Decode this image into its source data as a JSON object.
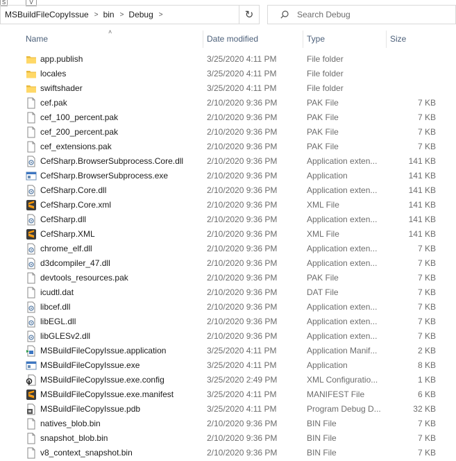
{
  "toolbar_stubs": [
    "S",
    "V"
  ],
  "address": {
    "crumbs": [
      "MSBuildFileCopyIssue",
      "bin",
      "Debug"
    ]
  },
  "search": {
    "placeholder": "Search Debug"
  },
  "columns": {
    "name": "Name",
    "date": "Date modified",
    "type": "Type",
    "size": "Size"
  },
  "files": [
    {
      "name": "app.publish",
      "date": "3/25/2020 4:11 PM",
      "type": "File folder",
      "size": "",
      "icon": "folder-icon"
    },
    {
      "name": "locales",
      "date": "3/25/2020 4:11 PM",
      "type": "File folder",
      "size": "",
      "icon": "folder-icon"
    },
    {
      "name": "swiftshader",
      "date": "3/25/2020 4:11 PM",
      "type": "File folder",
      "size": "",
      "icon": "folder-icon"
    },
    {
      "name": "cef.pak",
      "date": "2/10/2020 9:36 PM",
      "type": "PAK File",
      "size": "7 KB",
      "icon": "file-icon"
    },
    {
      "name": "cef_100_percent.pak",
      "date": "2/10/2020 9:36 PM",
      "type": "PAK File",
      "size": "7 KB",
      "icon": "file-icon"
    },
    {
      "name": "cef_200_percent.pak",
      "date": "2/10/2020 9:36 PM",
      "type": "PAK File",
      "size": "7 KB",
      "icon": "file-icon"
    },
    {
      "name": "cef_extensions.pak",
      "date": "2/10/2020 9:36 PM",
      "type": "PAK File",
      "size": "7 KB",
      "icon": "file-icon"
    },
    {
      "name": "CefSharp.BrowserSubprocess.Core.dll",
      "date": "2/10/2020 9:36 PM",
      "type": "Application exten...",
      "size": "141 KB",
      "icon": "dll-icon"
    },
    {
      "name": "CefSharp.BrowserSubprocess.exe",
      "date": "2/10/2020 9:36 PM",
      "type": "Application",
      "size": "141 KB",
      "icon": "exe-icon"
    },
    {
      "name": "CefSharp.Core.dll",
      "date": "2/10/2020 9:36 PM",
      "type": "Application exten...",
      "size": "141 KB",
      "icon": "dll-icon"
    },
    {
      "name": "CefSharp.Core.xml",
      "date": "2/10/2020 9:36 PM",
      "type": "XML File",
      "size": "141 KB",
      "icon": "sublime-icon"
    },
    {
      "name": "CefSharp.dll",
      "date": "2/10/2020 9:36 PM",
      "type": "Application exten...",
      "size": "141 KB",
      "icon": "dll-icon"
    },
    {
      "name": "CefSharp.XML",
      "date": "2/10/2020 9:36 PM",
      "type": "XML File",
      "size": "141 KB",
      "icon": "sublime-icon"
    },
    {
      "name": "chrome_elf.dll",
      "date": "2/10/2020 9:36 PM",
      "type": "Application exten...",
      "size": "7 KB",
      "icon": "dll-icon"
    },
    {
      "name": "d3dcompiler_47.dll",
      "date": "2/10/2020 9:36 PM",
      "type": "Application exten...",
      "size": "7 KB",
      "icon": "dll-icon"
    },
    {
      "name": "devtools_resources.pak",
      "date": "2/10/2020 9:36 PM",
      "type": "PAK File",
      "size": "7 KB",
      "icon": "file-icon"
    },
    {
      "name": "icudtl.dat",
      "date": "2/10/2020 9:36 PM",
      "type": "DAT File",
      "size": "7 KB",
      "icon": "file-icon"
    },
    {
      "name": "libcef.dll",
      "date": "2/10/2020 9:36 PM",
      "type": "Application exten...",
      "size": "7 KB",
      "icon": "dll-icon"
    },
    {
      "name": "libEGL.dll",
      "date": "2/10/2020 9:36 PM",
      "type": "Application exten...",
      "size": "7 KB",
      "icon": "dll-icon"
    },
    {
      "name": "libGLESv2.dll",
      "date": "2/10/2020 9:36 PM",
      "type": "Application exten...",
      "size": "7 KB",
      "icon": "dll-icon"
    },
    {
      "name": "MSBuildFileCopyIssue.application",
      "date": "3/25/2020 4:11 PM",
      "type": "Application Manif...",
      "size": "2 KB",
      "icon": "manifest-app-icon"
    },
    {
      "name": "MSBuildFileCopyIssue.exe",
      "date": "3/25/2020 4:11 PM",
      "type": "Application",
      "size": "8 KB",
      "icon": "exe-icon"
    },
    {
      "name": "MSBuildFileCopyIssue.exe.config",
      "date": "3/25/2020 2:49 PM",
      "type": "XML Configuratio...",
      "size": "1 KB",
      "icon": "config-icon"
    },
    {
      "name": "MSBuildFileCopyIssue.exe.manifest",
      "date": "3/25/2020 4:11 PM",
      "type": "MANIFEST File",
      "size": "6 KB",
      "icon": "sublime-icon"
    },
    {
      "name": "MSBuildFileCopyIssue.pdb",
      "date": "3/25/2020 4:11 PM",
      "type": "Program Debug D...",
      "size": "32 KB",
      "icon": "pdb-icon"
    },
    {
      "name": "natives_blob.bin",
      "date": "2/10/2020 9:36 PM",
      "type": "BIN File",
      "size": "7 KB",
      "icon": "file-icon"
    },
    {
      "name": "snapshot_blob.bin",
      "date": "2/10/2020 9:36 PM",
      "type": "BIN File",
      "size": "7 KB",
      "icon": "file-icon"
    },
    {
      "name": "v8_context_snapshot.bin",
      "date": "2/10/2020 9:36 PM",
      "type": "BIN File",
      "size": "7 KB",
      "icon": "file-icon"
    }
  ]
}
